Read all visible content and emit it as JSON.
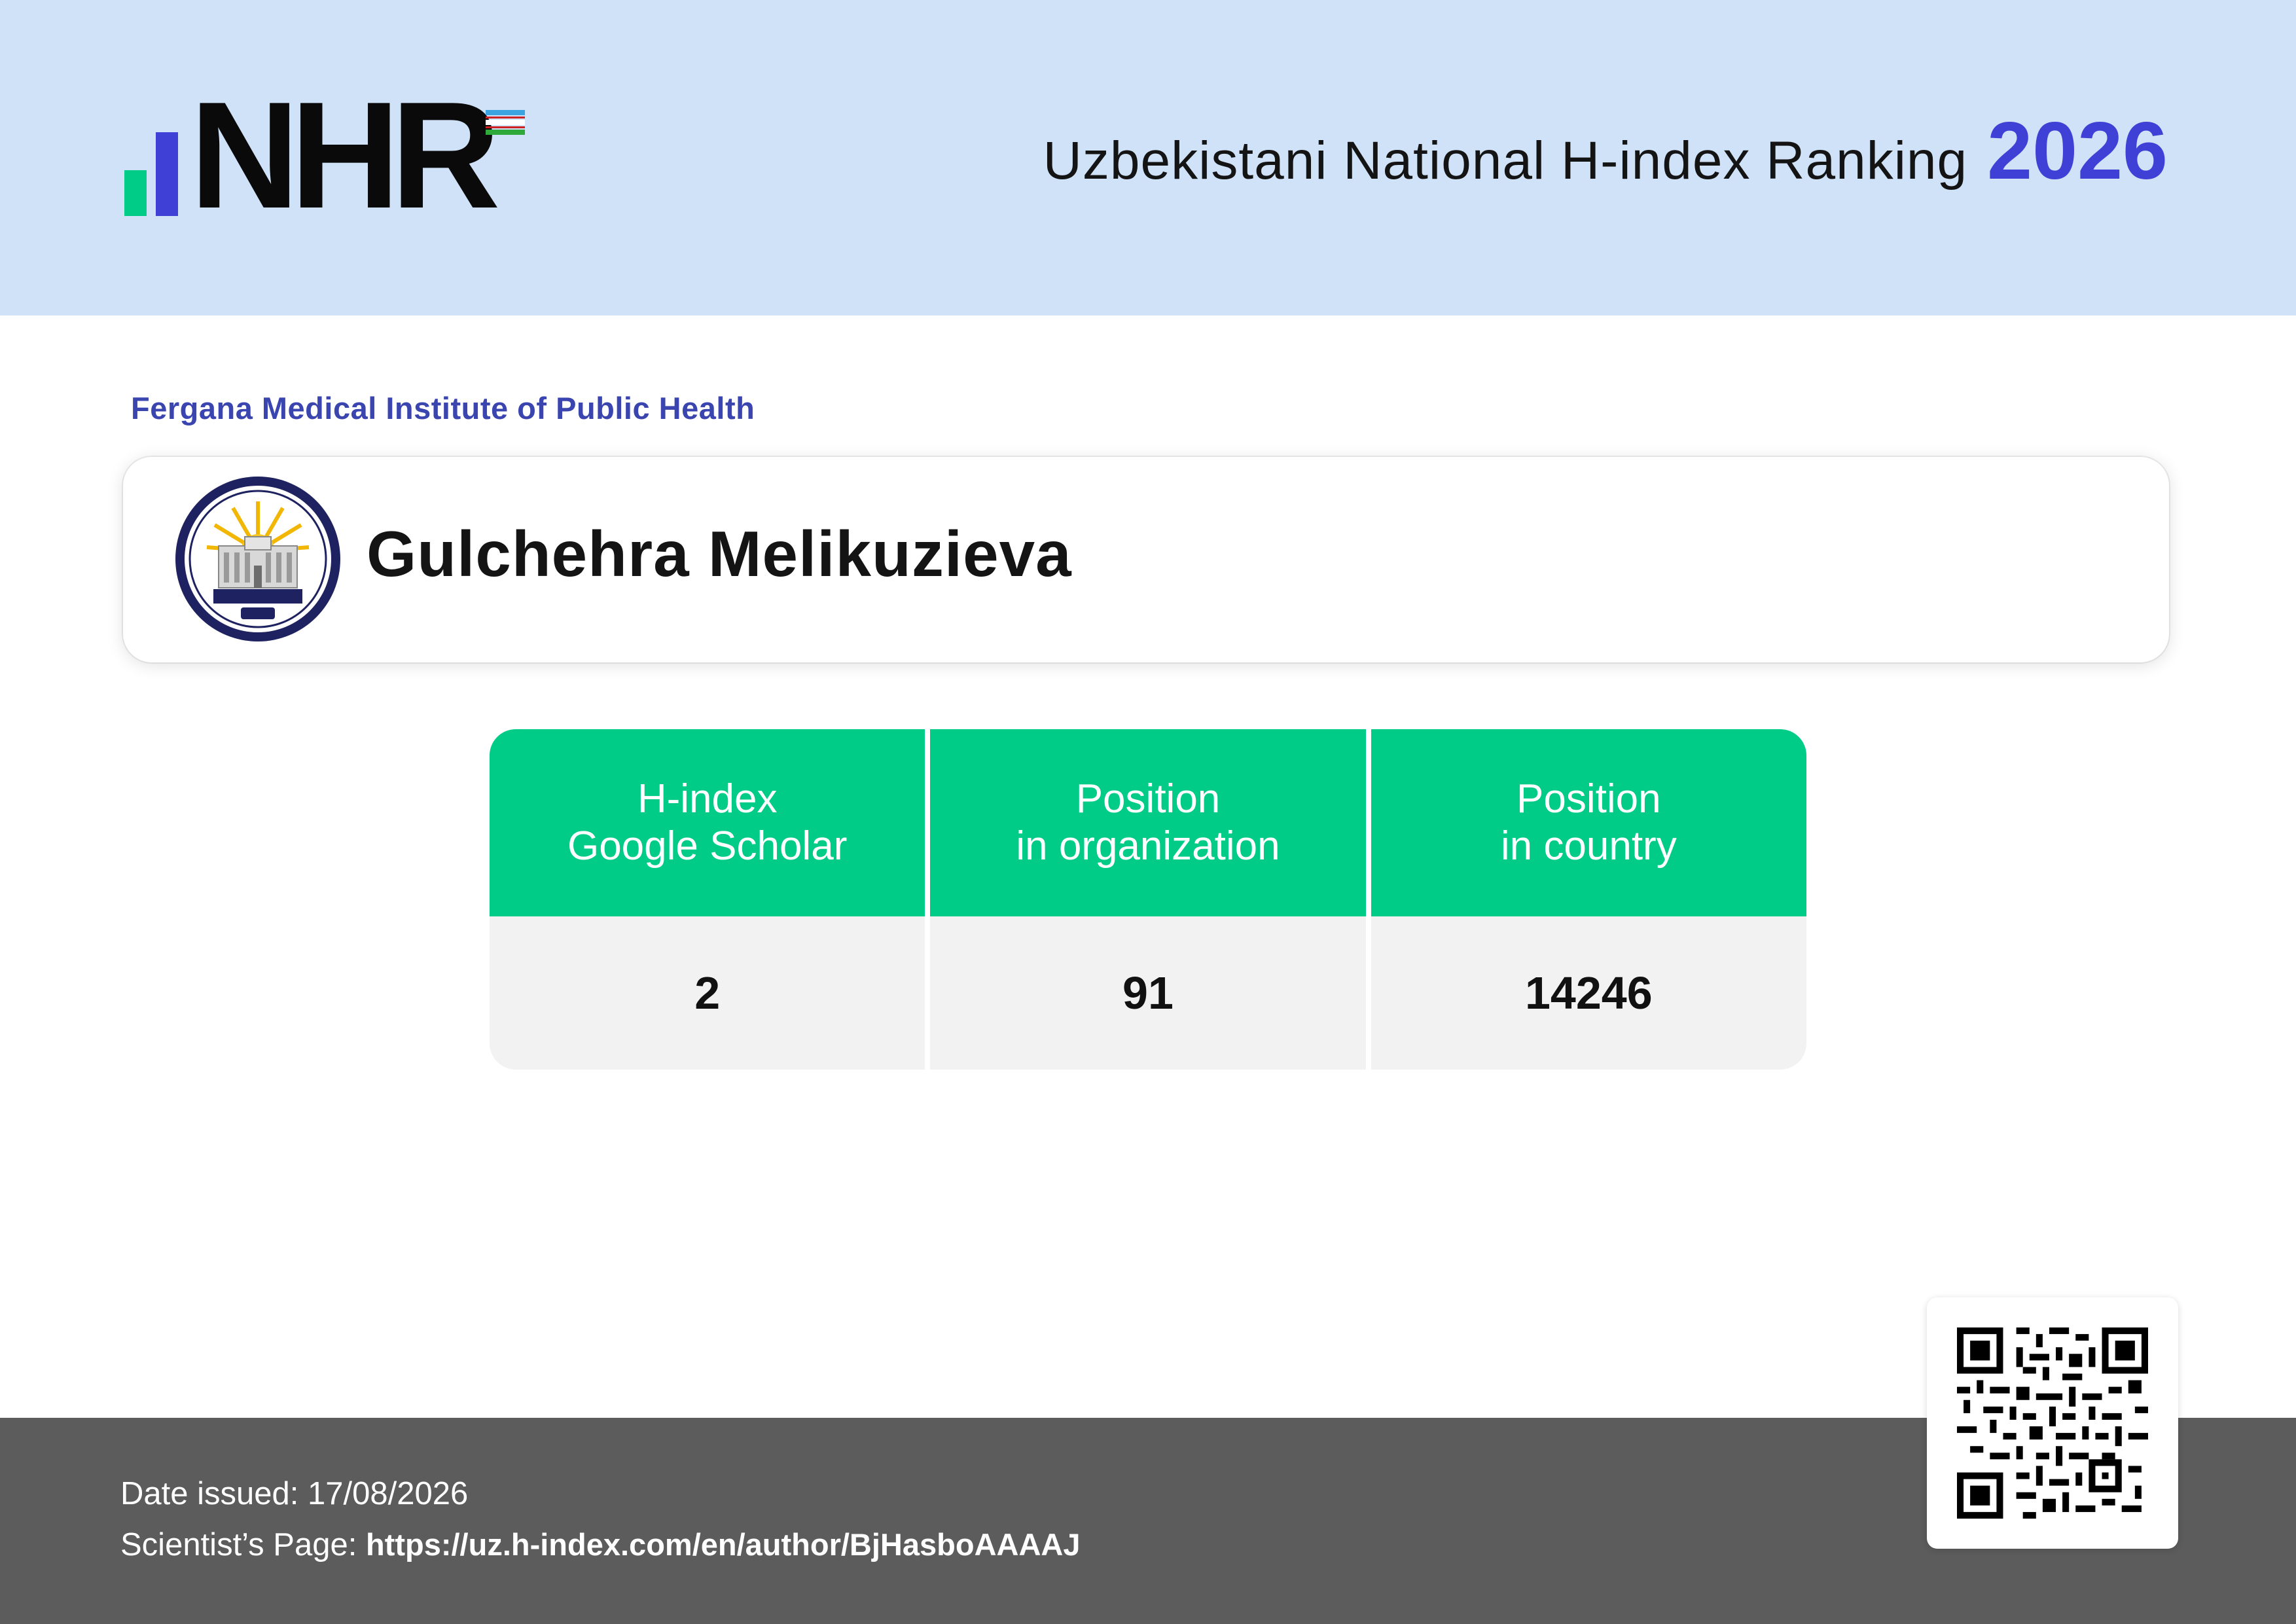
{
  "header": {
    "logo_text": "NHR",
    "title": "Uzbekistani National H-index Ranking",
    "year": "2026"
  },
  "organization": {
    "name": "Fergana Medical Institute of Public Health"
  },
  "scientist": {
    "name": "Gulchehra Melikuzieva"
  },
  "stats": [
    {
      "label_line1": "H-index",
      "label_line2": "Google Scholar",
      "value": "2"
    },
    {
      "label_line1": "Position",
      "label_line2": "in organization",
      "value": "91"
    },
    {
      "label_line1": "Position",
      "label_line2": "in country",
      "value": "14246"
    }
  ],
  "footer": {
    "date_label": "Date issued:",
    "date_value": "17/08/2026",
    "page_label": "Scientist’s Page:",
    "page_url": "https://uz.h-index.com/en/author/BjHasboAAAAJ"
  },
  "colors": {
    "header_bg": "#d0e2f8",
    "accent_green": "#00cc88",
    "accent_blue": "#3f41d6",
    "org_blue": "#3a45b0",
    "footer_bg": "#5c5c5c",
    "cell_bg": "#f2f2f2"
  },
  "icons": {
    "seal": "institute-seal-icon",
    "qr": "qr-code-icon",
    "flag": "uzbekistan-flag-icon"
  }
}
